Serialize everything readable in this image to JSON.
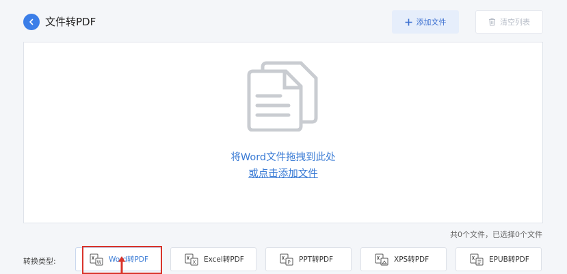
{
  "header": {
    "title": "文件转PDF",
    "add_label": "添加文件",
    "clear_label": "清空列表"
  },
  "drop_zone": {
    "line1": "将Word文件拖拽到此处",
    "line2": "或点击添加文件"
  },
  "status": {
    "file_count": "共0个文件，已选择0个文件"
  },
  "converter": {
    "label": "转换类型:",
    "types": [
      {
        "label": "Word转PDF",
        "icon": "word-file-icon",
        "active": true
      },
      {
        "label": "Excel转PDF",
        "icon": "excel-file-icon",
        "active": false
      },
      {
        "label": "PPT转PDF",
        "icon": "ppt-file-icon",
        "active": false
      },
      {
        "label": "XPS转PDF",
        "icon": "xps-file-icon",
        "active": false
      },
      {
        "label": "EPUB转PDF",
        "icon": "epub-file-icon",
        "active": false
      }
    ]
  },
  "colors": {
    "accent": "#3b7ee8",
    "link": "#3a7bd5",
    "highlight": "#d9342b"
  }
}
